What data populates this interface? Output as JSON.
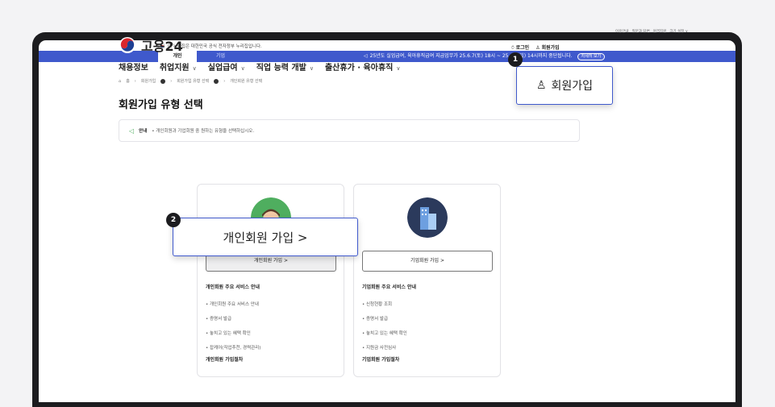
{
  "gov_banner": "이 누리집은 대한민국 공식 전자정부 누리집입니다.",
  "topbar": {
    "tab_personal": "개인",
    "tab_company": "기업",
    "notice": "25년도 실업급여, 육아휴직급여 지급업무가 25.6.7(토) 18시 ~ 25.6.8(일) 14시까지 중단됩니다.",
    "notice_button": "자세히 보기"
  },
  "util_links": [
    "이용안내",
    "질문과 답변",
    "원격지원",
    "크기 설정 ∨"
  ],
  "logo": {
    "text": "고용24"
  },
  "header_actions": {
    "login": "로그인",
    "signup": "회원가입"
  },
  "gnb": [
    "채용정보",
    "취업지원",
    "실업급여",
    "직업 능력 개발",
    "출산휴가 · 육아휴직"
  ],
  "breadcrumb": [
    "홈",
    "회원가입",
    "회원가입 유형 선택",
    "개인회원 유형 선택"
  ],
  "page_title": "회원가입 유형 선택",
  "info": {
    "label": "안내",
    "text": "• 개인회원과 기업회원 중 원하는 유형을 선택하십시오."
  },
  "cards": {
    "personal": {
      "button": "개인회원 가입 >",
      "service_title": "개인회원 주요 서비스 안내",
      "items": [
        "• 개인회원 주요 서비스 안내",
        "• 증명서 발급",
        "• 놓치고 있는 혜택 확인",
        "• 잡케어(직업추천, 경력관리)"
      ],
      "process_title": "개인회원 가입절차"
    },
    "company": {
      "button": "기업회원 가입 >",
      "service_title": "기업회원 주요 서비스 안내",
      "items": [
        "• 신청현황 조회",
        "• 증명서 발급",
        "• 놓치고 있는 혜택 확인",
        "• 지원금 사전심사"
      ],
      "process_title": "기업회원 가입절차"
    }
  },
  "callouts": {
    "one": {
      "number": "1",
      "label": "회원가입"
    },
    "two": {
      "number": "2",
      "label": "개인회원 가입 >"
    }
  },
  "colors": {
    "brand_blue": "#3f59cc",
    "green": "#4fae5f",
    "frame": "#1c1c1f"
  }
}
